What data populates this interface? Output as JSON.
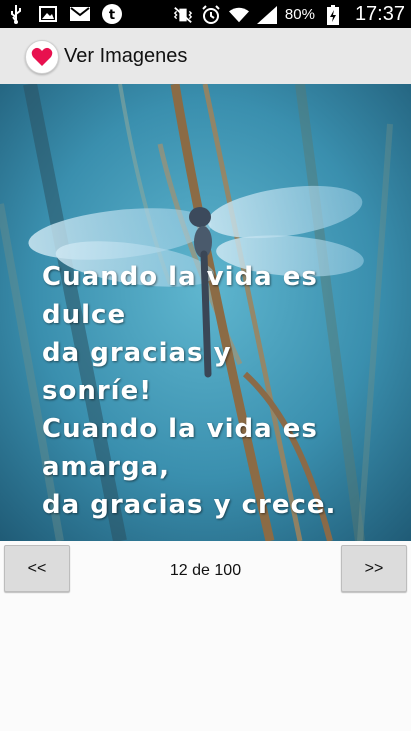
{
  "status_bar": {
    "battery": "80%",
    "time": "17:37",
    "icons": [
      "usb-icon",
      "image-icon",
      "gmail-icon",
      "tumblr-icon",
      "vibrate-mute-icon",
      "alarm-icon",
      "wifi-icon",
      "signal-icon",
      "battery-icon"
    ]
  },
  "action_bar": {
    "title": "Ver Imagenes",
    "app_icon": "heart-icon",
    "accent": "#e8114f"
  },
  "image": {
    "quote_lines": [
      "Cuando la vida es",
      "dulce",
      "da gracias y",
      "sonríe!",
      "Cuando la vida es",
      "amarga,",
      "da gracias y crece."
    ]
  },
  "navigation": {
    "prev_label": "<<",
    "next_label": ">>",
    "counter": "12 de 100"
  }
}
